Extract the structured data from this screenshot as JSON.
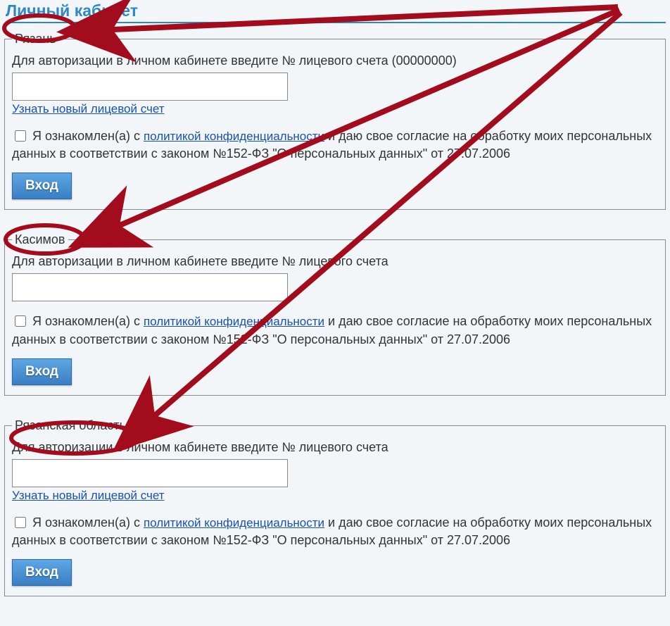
{
  "page_title": "Личный кабинет",
  "sections": [
    {
      "legend": "Рязань",
      "instruction": "Для авторизации в личном кабинете введите № лицевого счета (00000000)",
      "show_find_account_link": true,
      "find_account_label": "Узнать новый лицевой счет",
      "consent_prefix": "Я ознакомлен(а) с ",
      "policy_link": "политикой конфиденциальности",
      "consent_suffix": " и даю свое согласие на обработку моих персональных данных в соответствии с законом №152-ФЗ \"О персональных данных\" от 27.07.2006",
      "login_label": "Вход"
    },
    {
      "legend": "Касимов",
      "instruction": "Для авторизации в личном кабинете введите № лицевого счета",
      "show_find_account_link": false,
      "find_account_label": "",
      "consent_prefix": "Я ознакомлен(а) с ",
      "policy_link": "политикой конфиденциальности",
      "consent_suffix": " и даю свое согласие на обработку моих персональных данных в соответствии с законом №152-ФЗ \"О персональных данных\" от 27.07.2006",
      "login_label": "Вход"
    },
    {
      "legend": "Рязанская область",
      "instruction": "Для авторизации в личном кабинете введите № лицевого счета",
      "show_find_account_link": true,
      "find_account_label": "Узнать новый лицевой счет",
      "consent_prefix": "Я ознакомлен(а) с ",
      "policy_link": "политикой конфиденциальности",
      "consent_suffix": " и даю свое согласие на обработку моих персональных данных в соответствии с законом №152-ФЗ \"О персональных данных\" от 27.07.2006",
      "login_label": "Вход"
    }
  ],
  "annotation_color": "#a30c1c"
}
